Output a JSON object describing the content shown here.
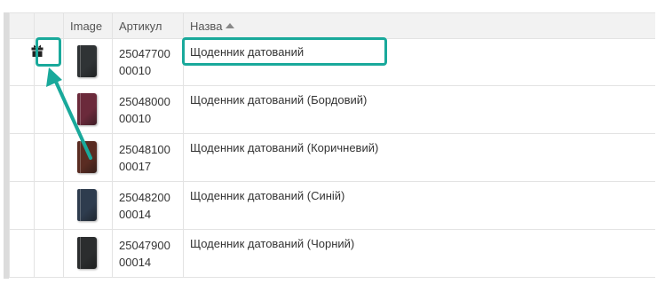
{
  "columns": {
    "image": "Image",
    "sku": "Артикул",
    "name": "Назва"
  },
  "rows": [
    {
      "sku": "2504770000010",
      "sku_line1": "25047700",
      "sku_line2": "00010",
      "name": "Щоденник датований",
      "cover_color": "#2f3335"
    },
    {
      "sku": "2504800000010",
      "sku_line1": "25048000",
      "sku_line2": "00010",
      "name": "Щоденник датований (Бордовий)",
      "cover_color": "#6b2a3b"
    },
    {
      "sku": "2504810000017",
      "sku_line1": "25048100",
      "sku_line2": "00017",
      "name": "Щоденник датований (Коричневий)",
      "cover_color": "#5a2c22"
    },
    {
      "sku": "2504820000014",
      "sku_line1": "25048200",
      "sku_line2": "00014",
      "name": "Щоденник датований (Синій)",
      "cover_color": "#2e3c4e"
    },
    {
      "sku": "2504790000014",
      "sku_line1": "25047900",
      "sku_line2": "00014",
      "name": "Щоденник датований (Чорний)",
      "cover_color": "#2b2d2e"
    }
  ],
  "icons": {
    "gift": "gift-icon",
    "sort": "sort-ascending-icon"
  },
  "colors": {
    "highlight": "#19a99b",
    "header_bg": "#f2f2f2"
  }
}
